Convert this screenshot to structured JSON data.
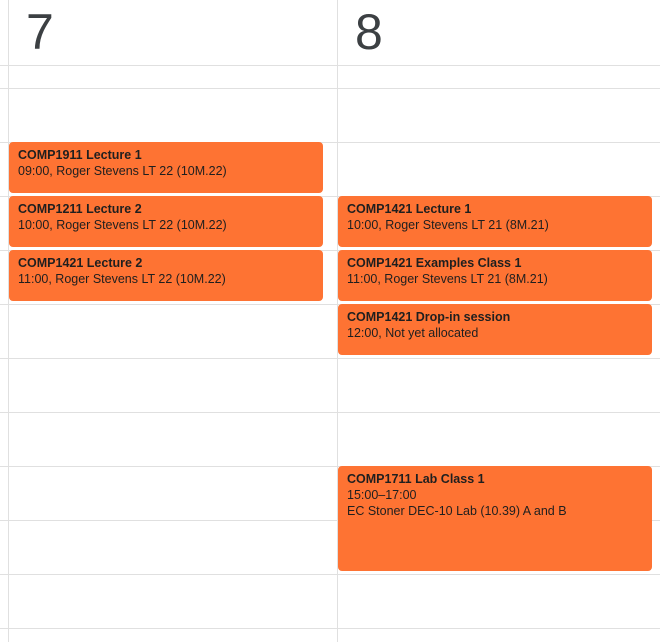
{
  "days": [
    {
      "number": "7"
    },
    {
      "number": "8"
    }
  ],
  "events": {
    "day7": [
      {
        "title": "COMP1911 Lecture 1",
        "line1": "09:00, Roger Stevens LT 22 (10M.22)"
      },
      {
        "title": "COMP1211 Lecture 2",
        "line1": "10:00, Roger Stevens LT 22 (10M.22)"
      },
      {
        "title": "COMP1421 Lecture 2",
        "line1": "11:00, Roger Stevens LT 22 (10M.22)"
      }
    ],
    "day8": [
      {
        "title": "COMP1421 Lecture 1",
        "line1": "10:00, Roger Stevens LT 21 (8M.21)"
      },
      {
        "title": "COMP1421 Examples Class 1",
        "line1": "11:00, Roger Stevens LT 21 (8M.21)"
      },
      {
        "title": "COMP1421 Drop-in session",
        "line1": "12:00, Not yet allocated"
      },
      {
        "title": "COMP1711 Lab Class 1",
        "line1": "15:00–17:00",
        "line2": "EC Stoner DEC-10 Lab (10.39) A and B"
      }
    ]
  },
  "colors": {
    "event_bg": "#fe7333",
    "gridline": "#e0e0e0",
    "day_number": "#3c4043"
  }
}
